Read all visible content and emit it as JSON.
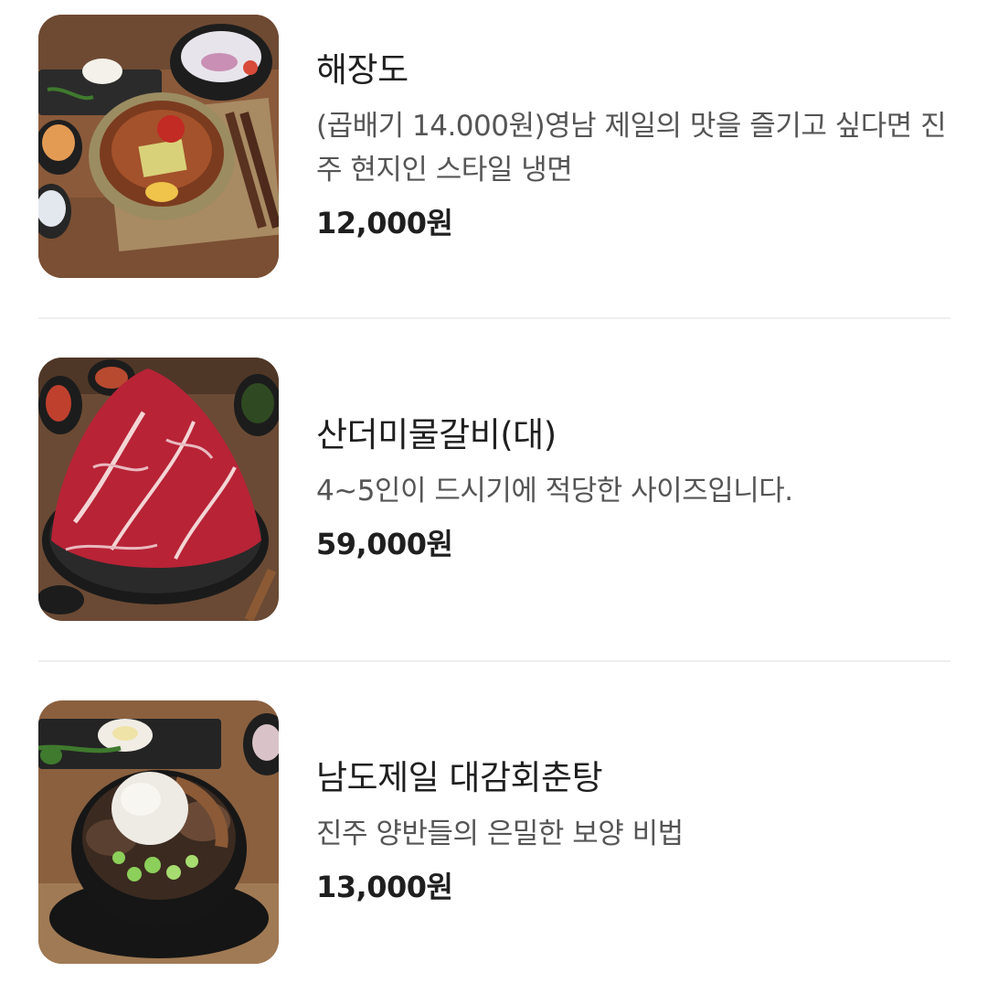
{
  "menu": {
    "items": [
      {
        "name": "해장도",
        "description": "(곱배기 14.000원)영남 제일의 맛을 즐기고 싶다면 진주 현지인 스타일 냉면",
        "price": "12,000원",
        "image": "cold-noodle-photo"
      },
      {
        "name": "산더미물갈비(대)",
        "description": "4~5인이 드시기에 적당한 사이즈입니다.",
        "price": "59,000원",
        "image": "raw-beef-mountain-photo"
      },
      {
        "name": "남도제일 대감회춘탕",
        "description": "진주 양반들의 은밀한 보양 비법",
        "price": "13,000원",
        "image": "stew-hotpot-photo"
      }
    ]
  }
}
